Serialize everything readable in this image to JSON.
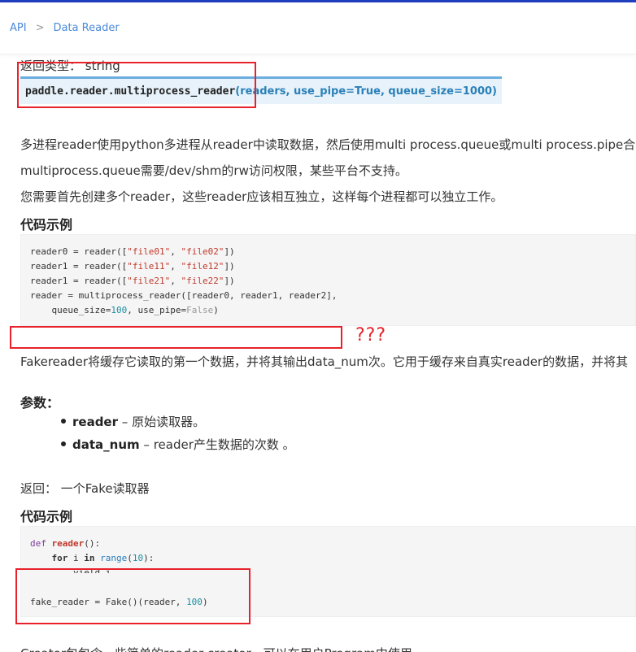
{
  "breadcrumb": {
    "items": [
      "API",
      "Data Reader"
    ],
    "separator": ">"
  },
  "section1": {
    "return_type": "返回类型： string",
    "signature": {
      "name": "paddle.reader.multiprocess_reader",
      "params": "(readers, use_pipe=True, queue_size=1000)"
    },
    "desc_lines": [
      "多进程reader使用python多进程从reader中读取数据，然后使用multi process.queue或multi process.pipe合并",
      "multiprocess.queue需要/dev/shm的rw访问权限，某些平台不支持。",
      "您需要首先创建多个reader，这些reader应该相互独立，这样每个进程都可以独立工作。"
    ],
    "code_heading": "代码示例",
    "code": {
      "l1": [
        "reader0 = reader([",
        "\"file01\"",
        ", ",
        "\"file02\"",
        "])"
      ],
      "l2": [
        "reader1 = reader([",
        "\"file11\"",
        ", ",
        "\"file12\"",
        "])"
      ],
      "l3": [
        "reader1 = reader([",
        "\"file21\"",
        ", ",
        "\"file22\"",
        "])"
      ],
      "l4": "reader = multiprocess_reader([reader0, reader1, reader2],",
      "l5": [
        "    queue_size=",
        "100",
        ", use_pipe=",
        "False",
        ")"
      ]
    }
  },
  "annotation": {
    "question_marks": "???"
  },
  "section2": {
    "desc": "Fakereader将缓存它读取的第一个数据，并将其输出data_num次。它用于缓存来自真实reader的数据，并将其",
    "params_heading": "参数：",
    "params": [
      {
        "name": "reader",
        "sep": " – ",
        "desc": "原始读取器。"
      },
      {
        "name": "data_num",
        "sep": " – ",
        "desc": "reader产生数据的次数 。"
      }
    ],
    "returns": "返回： 一个Fake读取器",
    "code_heading": "代码示例",
    "code": {
      "l1": [
        "def ",
        "reader",
        "():"
      ],
      "l2": [
        "    ",
        "for",
        " i ",
        "in",
        " ",
        "range",
        "(",
        "10",
        "):"
      ],
      "l3": [
        "        yield i"
      ],
      "l5": [
        "fake_reader = Fake()(reader, ",
        "100",
        ")"
      ]
    }
  },
  "footer_cutoff": "Creator包包含一些简单的reader creator，可以在用户Program中使用。",
  "colors": {
    "accent_link": "#4a8ad9",
    "annotation_red": "#e8212b",
    "signature_bg": "#e7f2fa",
    "top_bar": "#1f3fbf"
  }
}
